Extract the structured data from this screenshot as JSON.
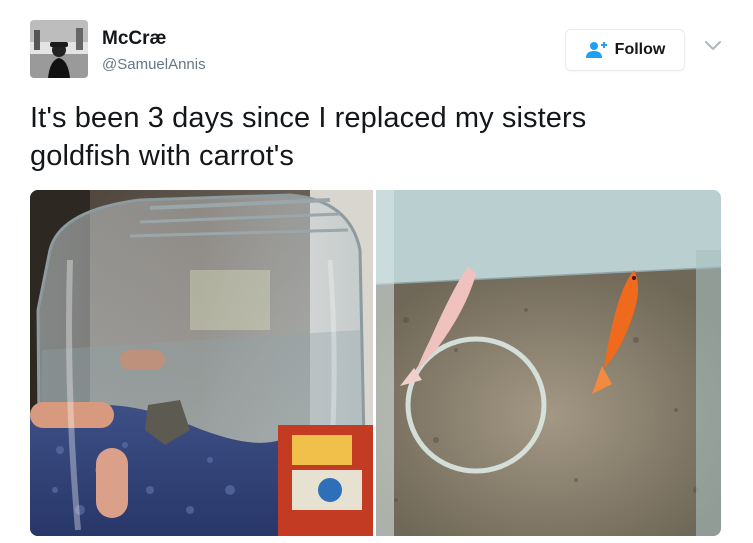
{
  "user": {
    "display_name": "McCræ",
    "handle": "@SamuelAnnis",
    "avatar_icon": "profile-photo"
  },
  "follow_button": {
    "label": "Follow",
    "icon": "add-user-icon",
    "accent": "#1da1f2"
  },
  "menu_icon": "chevron-down-icon",
  "tweet": {
    "text_line1": "It's been 3 days since I replaced my sisters",
    "text_line2": "goldfish with carrot's"
  },
  "media": {
    "left": "jar-with-carrots-photo",
    "right": "tank-with-goldfish-photo"
  },
  "colors": {
    "text": "#14171a",
    "secondary": "#657786",
    "border": "#e6ecf0"
  }
}
